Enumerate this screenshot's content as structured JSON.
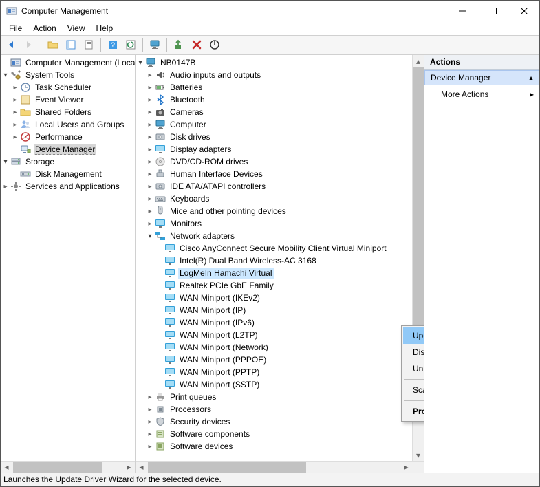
{
  "title": "Computer Management",
  "menu": {
    "file": "File",
    "action": "Action",
    "view": "View",
    "help": "Help"
  },
  "nav": {
    "root": "Computer Management (Local)",
    "system_tools": "System Tools",
    "task_scheduler": "Task Scheduler",
    "event_viewer": "Event Viewer",
    "shared_folders": "Shared Folders",
    "local_users": "Local Users and Groups",
    "performance": "Performance",
    "device_manager": "Device Manager",
    "storage": "Storage",
    "disk_management": "Disk Management",
    "services": "Services and Applications"
  },
  "device_root": "NB0147B",
  "categories": {
    "audio": "Audio inputs and outputs",
    "batteries": "Batteries",
    "bluetooth": "Bluetooth",
    "cameras": "Cameras",
    "computer": "Computer",
    "disk": "Disk drives",
    "display": "Display adapters",
    "dvd": "DVD/CD-ROM drives",
    "hid": "Human Interface Devices",
    "ide": "IDE ATA/ATAPI controllers",
    "keyboards": "Keyboards",
    "mice": "Mice and other pointing devices",
    "monitors": "Monitors",
    "network": "Network adapters",
    "print_queues": "Print queues",
    "processors": "Processors",
    "security": "Security devices",
    "software_comp": "Software components",
    "software_dev": "Software devices"
  },
  "adapters": {
    "cisco": "Cisco AnyConnect Secure Mobility Client Virtual Miniport",
    "intel": "Intel(R) Dual Band Wireless-AC 3168",
    "hamachi": "LogMeIn Hamachi Virtual",
    "realtek": "Realtek PCIe GbE Family",
    "wan_ikev2": "WAN Miniport (IKEv2)",
    "wan_ip": "WAN Miniport (IP)",
    "wan_ipv6": "WAN Miniport (IPv6)",
    "wan_l2tp": "WAN Miniport (L2TP)",
    "wan_net": "WAN Miniport (Network)",
    "wan_pppoe": "WAN Miniport (PPPOE)",
    "wan_pptp": "WAN Miniport (PPTP)",
    "wan_sstp": "WAN Miniport (SSTP)"
  },
  "context_menu": {
    "update": "Update driver",
    "disable": "Disable device",
    "uninstall": "Uninstall device",
    "scan": "Scan for hardware changes",
    "properties": "Properties"
  },
  "actions": {
    "header": "Actions",
    "group": "Device Manager",
    "more": "More Actions"
  },
  "status": "Launches the Update Driver Wizard for the selected device."
}
